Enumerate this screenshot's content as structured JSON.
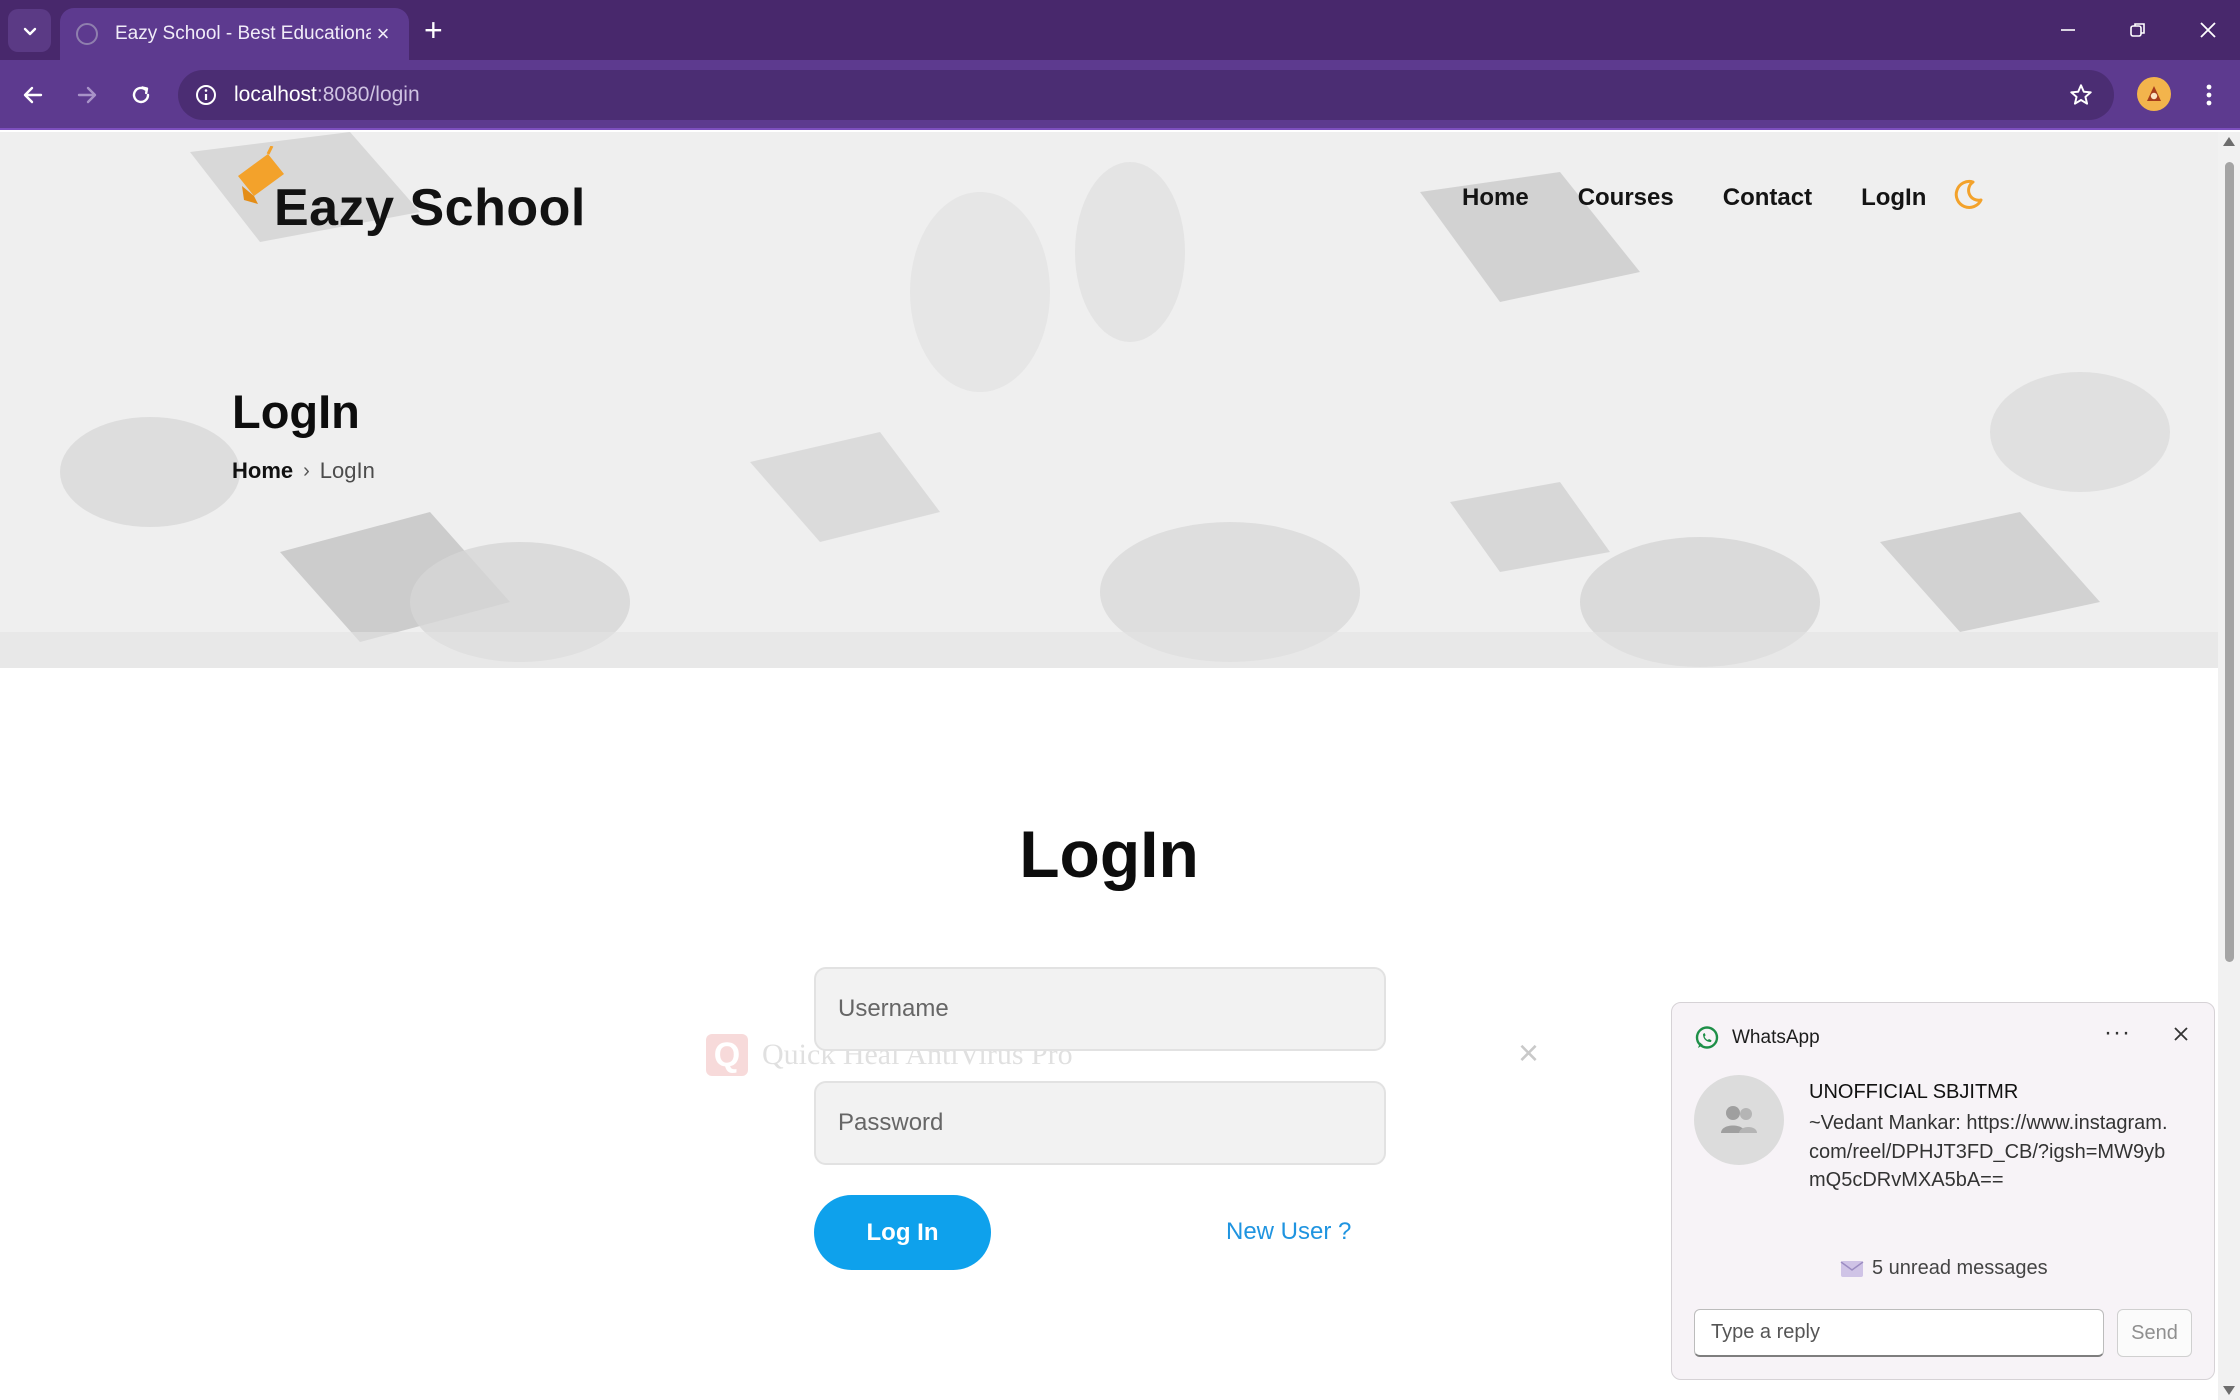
{
  "browser": {
    "tab_title": "Eazy School - Best Educational I",
    "tab_close": "×",
    "new_tab": "+",
    "url_host": "localhost",
    "url_rest": ":8080/login"
  },
  "site": {
    "logo": "Eazy School",
    "nav": [
      "Home",
      "Courses",
      "Contact",
      "LogIn"
    ],
    "accent_color": "#f3a22b"
  },
  "hero": {
    "title": "LogIn",
    "breadcrumb_home": "Home",
    "breadcrumb_sep": "›",
    "breadcrumb_current": "LogIn"
  },
  "login": {
    "heading": "LogIn",
    "username_placeholder": "Username",
    "password_placeholder": "Password",
    "submit_label": "Log In",
    "new_user_link": "New User ?",
    "button_color": "#0ea1ec"
  },
  "overlay": {
    "watermark_logo": "Q",
    "watermark_text": "Quick Heal AntiVirus Pro",
    "watermark_close": "×"
  },
  "notification": {
    "app": "WhatsApp",
    "more": "···",
    "sender": "UNOFFICIAL SBJITMR",
    "message": "~Vedant Mankar: https://www.instagram.com/reel/DPHJT3FD_CB/?igsh=MW9ybmQ5cDRvMXA5bA==",
    "unread": "5 unread messages",
    "reply_placeholder": "Type a reply",
    "send_label": "Send"
  },
  "icons": [
    "tab-search-icon",
    "back-icon",
    "forward-icon",
    "reload-icon",
    "info-icon",
    "star-icon",
    "profile-avatar-icon",
    "menu-icon",
    "minimize-icon",
    "restore-icon",
    "window-close-icon",
    "graduation-cap-icon",
    "moon-icon",
    "whatsapp-icon",
    "group-icon",
    "mail-icon",
    "close-icon"
  ]
}
